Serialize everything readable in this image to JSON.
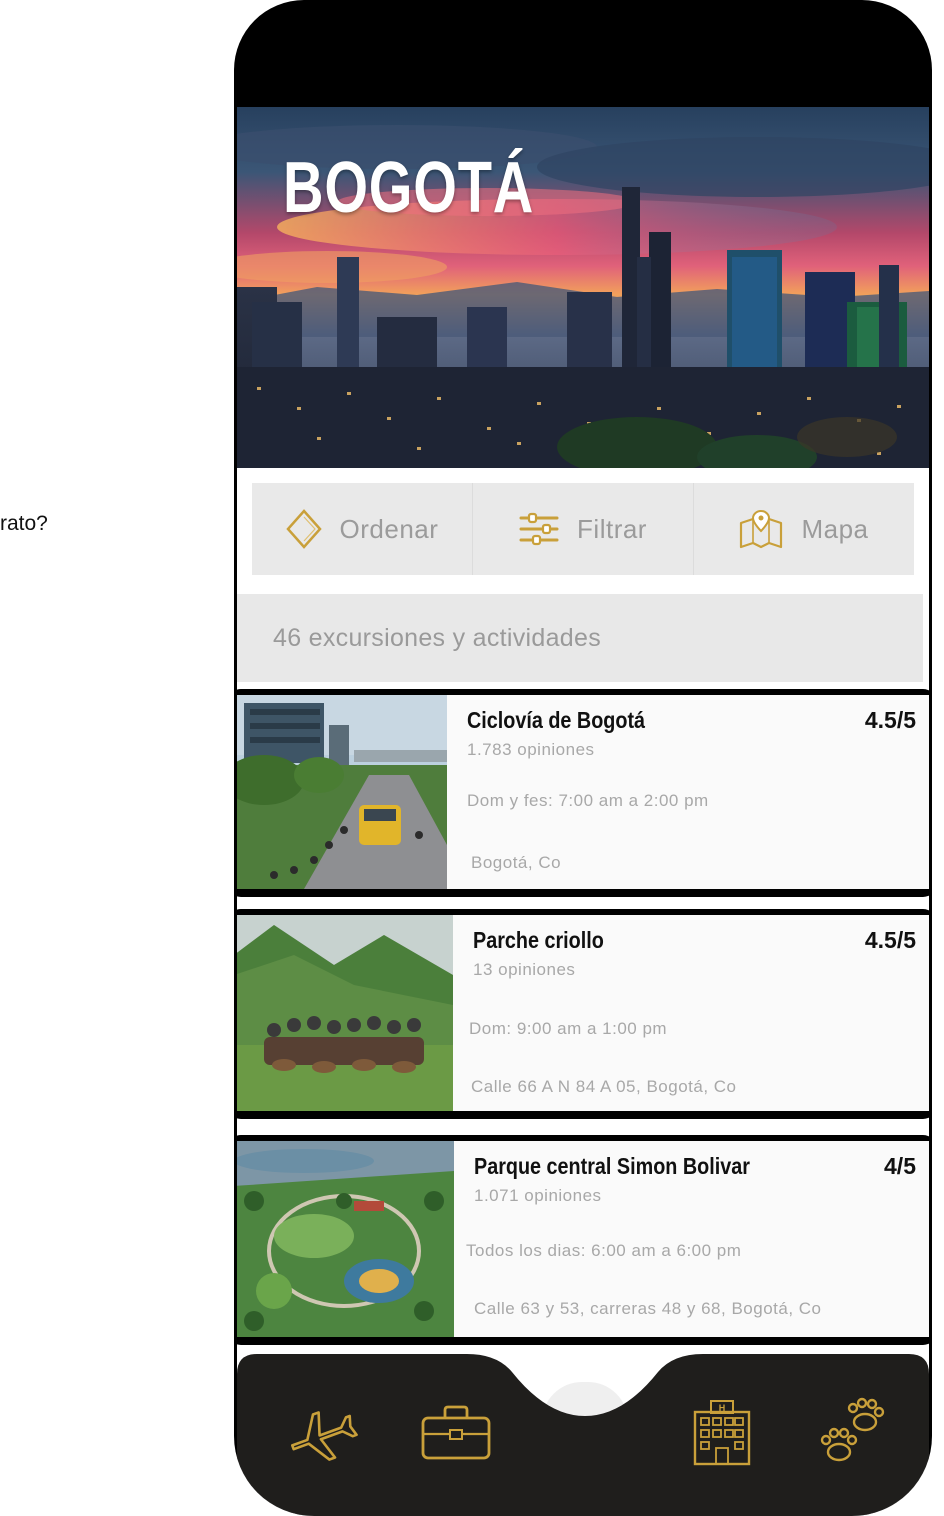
{
  "stray_text": "rato?",
  "hero": {
    "title": "BOGOTÁ"
  },
  "toolbar": {
    "sort_label": "Ordenar",
    "filter_label": "Filtrar",
    "map_label": "Mapa"
  },
  "results": {
    "count_text": "46 excursiones y actividades"
  },
  "cards": [
    {
      "title": "Ciclovía de Bogotá",
      "rating": "4.5/5",
      "reviews": "1.783 opiniones",
      "hours": "Dom y fes: 7:00 am a 2:00 pm",
      "place": "Bogotá, Co"
    },
    {
      "title": "Parche criollo",
      "rating": "4.5/5",
      "reviews": "13 opiniones",
      "hours": "Dom: 9:00 am a 1:00 pm",
      "place": "Calle 66 A N 84 A 05, Bogotá, Co"
    },
    {
      "title": "Parque central Simon Bolivar",
      "rating": "4/5",
      "reviews": "1.071 opiniones",
      "hours": "Todos los dias: 6:00 am a 6:00 pm",
      "place": "Calle 63 y 53, carreras 48 y 68, Bogotá, Co"
    }
  ],
  "nav": {
    "items": [
      {
        "icon": "airplane-icon"
      },
      {
        "icon": "briefcase-icon"
      },
      {
        "icon": "hotel-icon"
      },
      {
        "icon": "paw-icon"
      }
    ]
  },
  "colors": {
    "accent_gold": "#c9a03a",
    "nav_bg": "#1f1e1c",
    "toolbar_bg": "#e9e9e9",
    "muted_text": "#a8a8a8"
  }
}
